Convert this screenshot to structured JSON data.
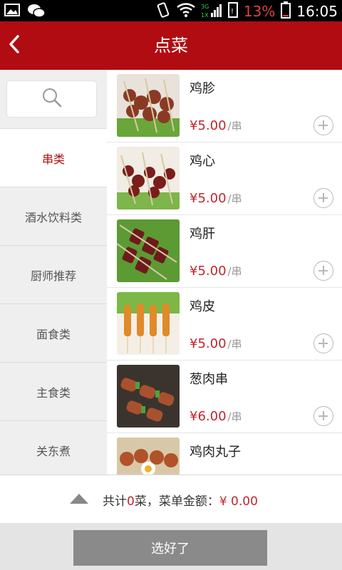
{
  "status_bar": {
    "network": "3G 1X",
    "battery_percent": "13%",
    "time": "16:05"
  },
  "header": {
    "title": "点菜",
    "back_icon": "chevron-left-icon"
  },
  "sidebar": {
    "search_icon": "search-icon",
    "categories": [
      {
        "label": "串类",
        "active": true
      },
      {
        "label": "酒水饮料类",
        "active": false
      },
      {
        "label": "厨师推荐",
        "active": false
      },
      {
        "label": "面食类",
        "active": false
      },
      {
        "label": "主食类",
        "active": false
      },
      {
        "label": "关东煮",
        "active": false
      }
    ]
  },
  "items": [
    {
      "name": "鸡胗",
      "price": "¥5.00",
      "unit": "/串"
    },
    {
      "name": "鸡心",
      "price": "¥5.00",
      "unit": "/串"
    },
    {
      "name": "鸡肝",
      "price": "¥5.00",
      "unit": "/串"
    },
    {
      "name": "鸡皮",
      "price": "¥5.00",
      "unit": "/串"
    },
    {
      "name": "葱肉串",
      "price": "¥6.00",
      "unit": "/串"
    },
    {
      "name": "鸡肉丸子",
      "price": "",
      "unit": ""
    }
  ],
  "summary": {
    "prefix": "共计",
    "count": "0",
    "middle": "菜，菜单金额：",
    "amount": "¥ 0.00"
  },
  "confirm_label": "选好了",
  "colors": {
    "brand": "#b10c12",
    "price": "#c0262d"
  }
}
